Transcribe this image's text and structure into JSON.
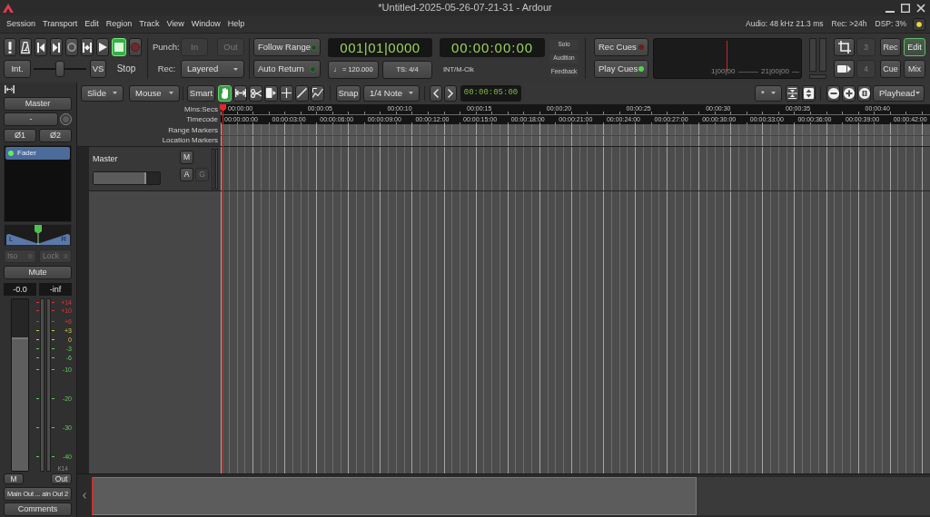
{
  "window": {
    "title": "*Untitled-2025-05-26-07-21-31 - Ardour"
  },
  "menu_bar": {
    "items": [
      "Session",
      "Transport",
      "Edit",
      "Region",
      "Track",
      "View",
      "Window",
      "Help"
    ],
    "status": [
      "Audio: 48 kHz 21.3 ms",
      "Rec: >24h",
      "DSP: 3%"
    ]
  },
  "transport": {
    "buttons": [
      {
        "kind": "panic",
        "active": false
      },
      {
        "kind": "metronome",
        "active": false
      },
      {
        "kind": "start",
        "active": false
      },
      {
        "kind": "end",
        "active": false
      },
      {
        "kind": "loop",
        "active": false
      },
      {
        "kind": "range",
        "active": false
      },
      {
        "kind": "play",
        "active": false
      },
      {
        "kind": "stop",
        "active": true
      },
      {
        "kind": "record",
        "active": false
      }
    ],
    "int_button": "Int.",
    "shuttle": {
      "level": 0.5
    },
    "vs_button": "VS",
    "state": "Stop"
  },
  "punch": {
    "label": "Punch:",
    "buttons": [
      {
        "label": "In",
        "on": false
      },
      {
        "label": "Out",
        "on": false
      }
    ]
  },
  "record_mode": {
    "label": "Rec:",
    "value": "Layered"
  },
  "options": [
    {
      "label": "Follow Range",
      "on": false
    },
    {
      "label": "Auto Return",
      "on": false
    }
  ],
  "clocks": {
    "primary": "001|01|0000",
    "secondary": "00:00:00:00",
    "tempo": "♩ = 120.000",
    "meter": "TS: 4/4",
    "sync": "INT/M-Clk"
  },
  "monitor_section": [
    "Solo",
    "Audition",
    "Feedback"
  ],
  "cues": [
    {
      "label": "Rec Cues",
      "color": "#6a1e1e"
    },
    {
      "label": "Play Cues",
      "color": "#52d452"
    }
  ],
  "mini_timeline": {
    "labels": [
      "1|00|00",
      "21|00|00"
    ]
  },
  "layout_buttons": [
    {
      "label": "3",
      "disabled": true
    },
    {
      "label": "4",
      "disabled": true
    }
  ],
  "window_tabs": [
    {
      "label": "Rec",
      "selected": false
    },
    {
      "label": "Edit",
      "selected": true
    },
    {
      "label": "Cue",
      "selected": false
    },
    {
      "label": "Mix",
      "selected": false
    }
  ],
  "editor_toolbar": {
    "edit_mode": "Slide",
    "edit_point": "Mouse",
    "smart": "Smart",
    "tools": [
      {
        "kind": "grab",
        "selected": true
      },
      {
        "kind": "range",
        "selected": false
      },
      {
        "kind": "cut",
        "selected": false
      },
      {
        "kind": "content",
        "selected": false
      },
      {
        "kind": "stretch",
        "selected": false
      },
      {
        "kind": "draw",
        "selected": false
      },
      {
        "kind": "internal",
        "selected": false
      }
    ],
    "snap": "Snap",
    "grid": "1/4 Note",
    "nudge_clock": "00:00:05:00",
    "visible_tracks": "*",
    "zoom_focus": "Playhead"
  },
  "rulers": {
    "labels": [
      "Mins:Secs",
      "Timecode",
      "Range Markers",
      "Location Markers"
    ],
    "mins_secs": [
      "00:00:00",
      "00:00:05",
      "00:00:10",
      "00:00:15",
      "00:00:20",
      "00:00:25",
      "00:00:30",
      "00:00:35",
      "00:00:40"
    ],
    "timecode": [
      "00:00:00:00",
      "00:00:03:00",
      "00:00:06:00",
      "00:00:09:00",
      "00:00:12:00",
      "00:00:15:00",
      "00:00:18:00",
      "00:00:21:00",
      "00:00:24:00",
      "00:00:27:00",
      "00:00:30:00",
      "00:00:33:00",
      "00:00:36:00",
      "00:00:39:00",
      "00:00:42:00"
    ]
  },
  "tracks": [
    {
      "name": "Master",
      "level": 0.8,
      "buttons": [
        {
          "label": "M",
          "disabled": false
        },
        {
          "label": "A",
          "disabled": false
        },
        {
          "label": "G",
          "disabled": true
        }
      ]
    }
  ],
  "strip": {
    "name": "Master",
    "input": "-",
    "polarity": [
      "Ø1",
      "Ø2"
    ],
    "processors": [
      {
        "label": "Fader",
        "selected": true,
        "on": true
      }
    ],
    "pan": {
      "labels": [
        "L",
        "R"
      ],
      "level": 0.5
    },
    "toggles": [
      {
        "label": "Iso",
        "disabled": true
      },
      {
        "label": "Lock",
        "disabled": true
      }
    ],
    "mute": "Mute",
    "gain": "-0.0",
    "peak": "-inf",
    "fader": {
      "level": 0.78
    },
    "meter_scale": [
      {
        "label": "+14",
        "color": "#d93a3a"
      },
      {
        "label": "+10",
        "color": "#d93a3a"
      },
      {
        "label": "+6",
        "color": "#d93a3a"
      },
      {
        "label": "+3",
        "color": "#d8c84a"
      },
      {
        "label": "0",
        "color": "#d8c84a"
      },
      {
        "label": "-3",
        "color": "#5fd05a"
      },
      {
        "label": "-6",
        "color": "#5fd05a"
      },
      {
        "label": "-10",
        "color": "#5fd05a"
      },
      {
        "label": "-20",
        "color": "#5fd05a"
      },
      {
        "label": "-30",
        "color": "#5fd05a"
      },
      {
        "label": "-40",
        "color": "#5fd05a"
      }
    ],
    "meter_type": "K14",
    "meter_point": "M",
    "output_button": "Out",
    "output": "Main Out ... ain Out 2",
    "comments": "Comments"
  }
}
